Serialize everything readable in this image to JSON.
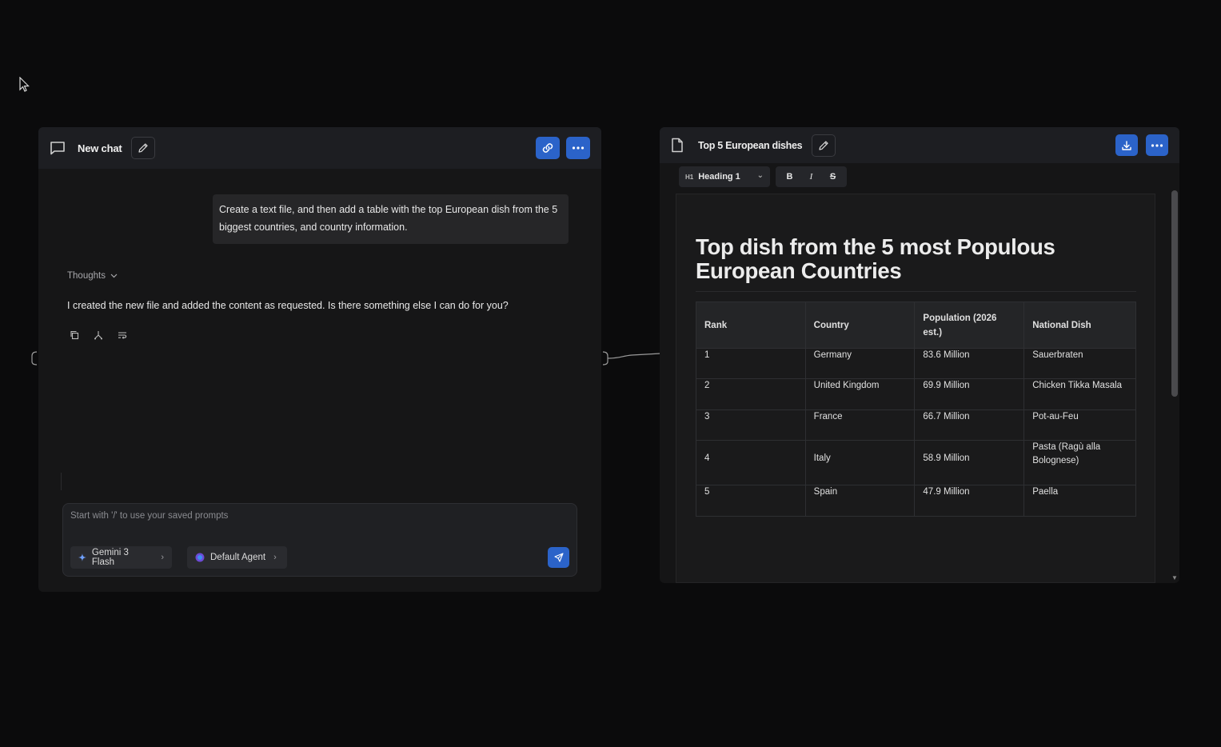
{
  "chat": {
    "title": "New chat",
    "user_message": "Create a text file, and then add a table with the top European dish from the 5 biggest countries, and country information.",
    "thoughts_label": "Thoughts",
    "reply": "I created the new file and added the content as requested. Is there something else I can do for you?",
    "composer_placeholder": "Start with '/' to use your saved prompts",
    "model_label": "Gemini 3 Flash",
    "agent_label": "Default Agent"
  },
  "doc": {
    "title": "Top 5 European dishes",
    "style_select": "Heading 1",
    "toolbar": {
      "bold": "B",
      "italic": "I",
      "strike": "S"
    },
    "heading": "Top dish from the 5 most Populous European Countries",
    "table": {
      "headers": [
        "Rank",
        "Country",
        "Population (2026 est.)",
        "National Dish"
      ],
      "rows": [
        [
          "1",
          "Germany",
          "83.6 Million",
          "Sauerbraten"
        ],
        [
          "2",
          "United Kingdom",
          "69.9 Million",
          "Chicken Tikka Masala"
        ],
        [
          "3",
          "France",
          "66.7 Million",
          "Pot-au-Feu"
        ],
        [
          "4",
          "Italy",
          "58.9 Million",
          "Pasta (Ragù alla Bolognese)"
        ],
        [
          "5",
          "Spain",
          "47.9 Million",
          "Paella"
        ]
      ]
    }
  },
  "colors": {
    "accent": "#2b63c9",
    "background": "#0b0b0c",
    "panel": "#161617",
    "header": "#1d1e22"
  }
}
